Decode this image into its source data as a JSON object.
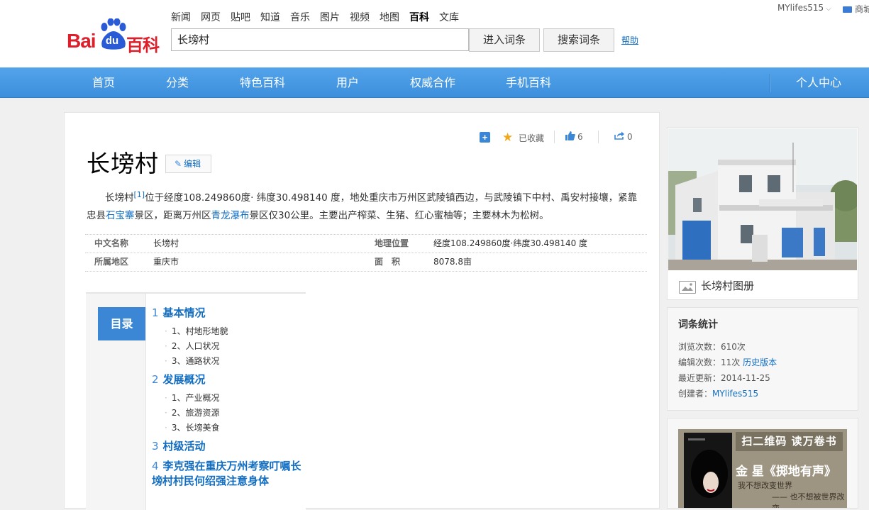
{
  "header": {
    "logo_text": "Bai du 百科",
    "nav": [
      "新闻",
      "网页",
      "贴吧",
      "知道",
      "音乐",
      "图片",
      "视频",
      "地图",
      "百科",
      "文库"
    ],
    "nav_active_index": 8,
    "search_value": "长塝村",
    "enter_button": "进入词条",
    "search_button": "搜索词条",
    "help": "帮助",
    "user": "MYlifes515",
    "shop": "商城"
  },
  "bluenav": {
    "items": [
      "首页",
      "分类",
      "特色百科",
      "用户",
      "权威合作",
      "手机百科"
    ],
    "right": "个人中心"
  },
  "toolbar": {
    "favorited": "已收藏",
    "likes": "6",
    "shares": "0"
  },
  "article": {
    "title": "长塝村",
    "edit": "编辑",
    "summary_parts": {
      "p1": "长塝村",
      "ref": "[1]",
      "p2": "位于经度108.249860度· 纬度30.498140 度，地处重庆市万州区武陵镇西边，与武陵镇下中村、禹安村接壤，紧靠忠县",
      "link1": "石宝寨",
      "p3": "景区，距离万州区",
      "link2": "青龙瀑布",
      "p4": "景区仅30公里。主要出产榨菜、生猪、红心蜜柚等；主要林木为松树。"
    },
    "basic_info": {
      "k1": "中文名称",
      "v1": "长塝村",
      "k2": "地理位置",
      "v2": "经度108.249860度·纬度30.498140 度",
      "k3": "所属地区",
      "v3": "重庆市",
      "k4": "面　积",
      "v4": "8078.8亩"
    }
  },
  "toc": {
    "label": "目录",
    "sections": [
      {
        "num": "1",
        "title": "基本情况",
        "subs": [
          "1、村地形地貌",
          "2、人口状况",
          "3、通路状况"
        ]
      },
      {
        "num": "2",
        "title": "发展概况",
        "subs": [
          "1、产业概况",
          "2、旅游资源",
          "3、长塝美食"
        ]
      },
      {
        "num": "3",
        "title": "村级活动",
        "subs": []
      },
      {
        "num": "4",
        "title": "李克强在重庆万州考察叮嘱长塝村村民何绍强注意身体",
        "subs": []
      }
    ]
  },
  "sidebar": {
    "album": "长塝村图册",
    "stats": {
      "title": "词条统计",
      "views": "浏览次数：610次",
      "edits_prefix": "编辑次数：11次 ",
      "history": "历史版本",
      "updated": "最近更新：2014-11-25",
      "creator_prefix": "创建者：",
      "creator": "MYlifes515"
    },
    "ad": {
      "line1": "扫二维码  读万卷书",
      "line2": "金 星《掷地有声》",
      "line3": "我不想改变世界",
      "line4": "—— 也不想被世界改变"
    }
  }
}
